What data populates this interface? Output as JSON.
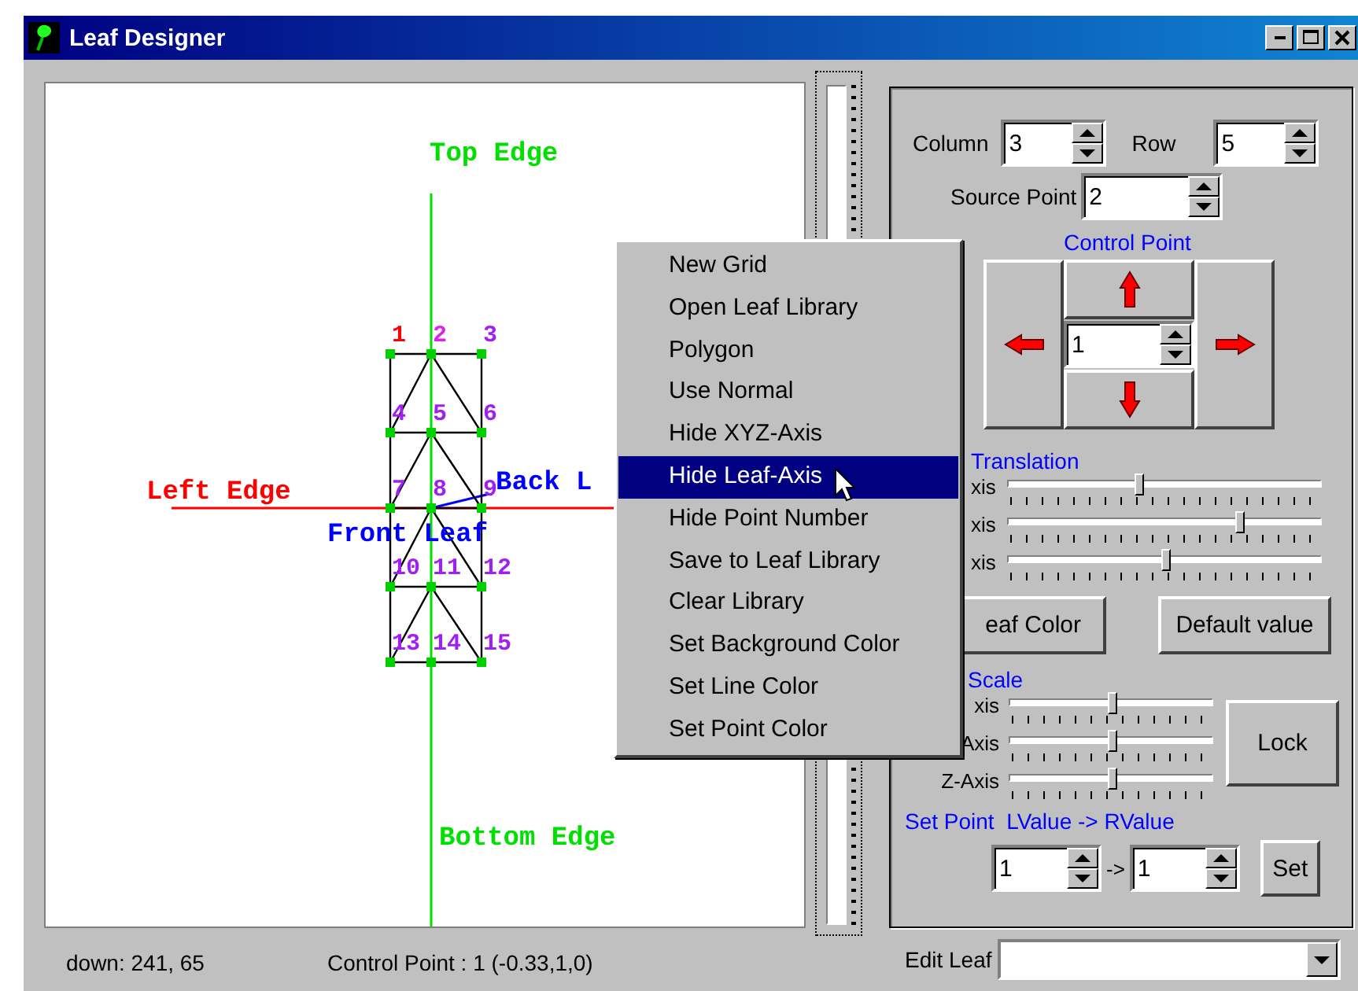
{
  "window": {
    "title": "Leaf Designer"
  },
  "canvas": {
    "axis_labels": [
      {
        "kind": "top",
        "text": "Top Edge",
        "color": "#00e000"
      },
      {
        "kind": "left",
        "text": "Left Edge",
        "color": "#ff0000"
      },
      {
        "kind": "back",
        "text": "Back L",
        "color": "#0000ff"
      },
      {
        "kind": "front",
        "text": "Front Leaf",
        "color": "#0000ff"
      },
      {
        "kind": "bottom",
        "text": "Bottom Edge",
        "color": "#00e000"
      }
    ],
    "points": [
      {
        "label": "1",
        "color": "#ff0000"
      },
      {
        "label": "2",
        "color": "#e020f0"
      },
      {
        "label": "3",
        "color": "#a020f0"
      },
      {
        "label": "4",
        "color": "#a020f0"
      },
      {
        "label": "5",
        "color": "#a020f0"
      },
      {
        "label": "6",
        "color": "#a020f0"
      },
      {
        "label": "7",
        "color": "#a020f0"
      },
      {
        "label": "8",
        "color": "#a020f0"
      },
      {
        "label": "9",
        "color": "#a020f0"
      },
      {
        "label": "10",
        "color": "#a020f0"
      },
      {
        "label": "11",
        "color": "#a020f0"
      },
      {
        "label": "12",
        "color": "#a020f0"
      },
      {
        "label": "13",
        "color": "#a020f0"
      },
      {
        "label": "14",
        "color": "#a020f0"
      },
      {
        "label": "15",
        "color": "#a020f0"
      }
    ]
  },
  "context_menu": {
    "items": [
      {
        "label": "New Grid",
        "selected": false
      },
      {
        "label": "Open Leaf Library",
        "selected": false
      },
      {
        "label": "Polygon",
        "selected": false
      },
      {
        "label": "Use Normal",
        "selected": false
      },
      {
        "label": "Hide XYZ-Axis",
        "selected": false
      },
      {
        "label": "Hide Leaf-Axis",
        "selected": true
      },
      {
        "label": "Hide Point Number",
        "selected": false
      },
      {
        "label": "Save to Leaf Library",
        "selected": false
      },
      {
        "label": "Clear Library",
        "selected": false
      },
      {
        "label": "Set Background Color",
        "selected": false
      },
      {
        "label": "Set Line Color",
        "selected": false
      },
      {
        "label": "Set Point Color",
        "selected": false
      }
    ]
  },
  "grid": {
    "column_label": "Column",
    "column_value": "3",
    "row_label": "Row",
    "row_value": "5"
  },
  "source_point": {
    "label": "Source Point",
    "value": "2"
  },
  "control_point": {
    "title": "Control Point",
    "value": "1"
  },
  "translation": {
    "title": "Translation",
    "sliders": [
      {
        "label": "xis",
        "level": 0.42
      },
      {
        "label": "xis",
        "level": 0.745
      },
      {
        "label": "xis",
        "level": 0.505
      }
    ]
  },
  "buttons": [
    "eaf Color",
    "Default value"
  ],
  "scale": {
    "title": "Scale",
    "sliders": [
      {
        "label": "xis",
        "level": 0.51
      },
      {
        "label": "Axis",
        "level": 0.51
      },
      {
        "label": "Z-Axis",
        "level": 0.51
      }
    ],
    "lock_button": "Lock"
  },
  "set_point": {
    "title": "Set Point  LValue -> RValue",
    "left_value": "1",
    "arrow": "->",
    "right_value": "1",
    "button": "Set"
  },
  "edit_leaf": {
    "label": "Edit Leaf"
  },
  "status_bar": {
    "cursor": "down: 241, 65",
    "control_point": "Control Point : 1 (-0.33,1,0)"
  }
}
